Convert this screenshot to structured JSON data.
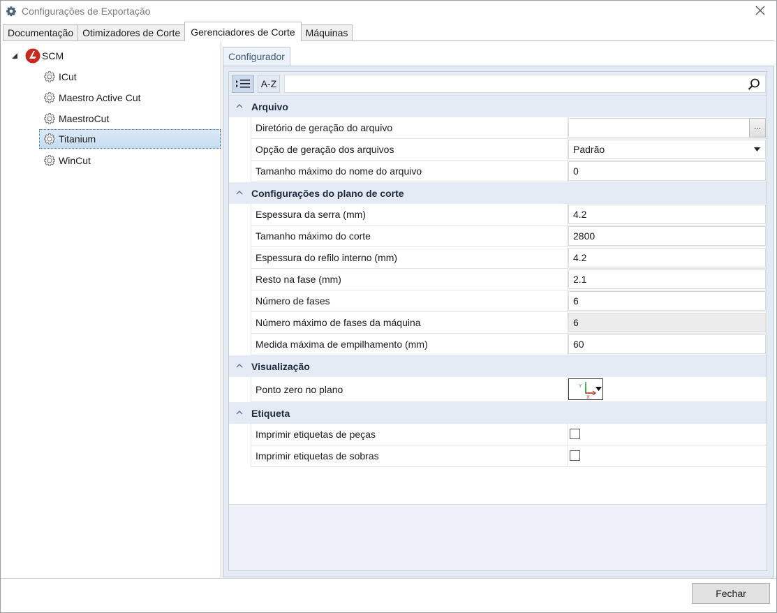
{
  "window": {
    "title": "Configurações de Exportação",
    "icon": "gear-icon",
    "close_icon": "close-icon"
  },
  "tabs": [
    {
      "label": "Documentação"
    },
    {
      "label": "Otimizadores de Corte"
    },
    {
      "label": "Gerenciadores de Corte",
      "active": true
    },
    {
      "label": "Máquinas"
    }
  ],
  "tree": {
    "root": {
      "label": "SCM",
      "icon": "scm-logo-icon"
    },
    "items": [
      {
        "label": "ICut",
        "icon": "gear-icon"
      },
      {
        "label": "Maestro Active Cut",
        "icon": "gear-icon"
      },
      {
        "label": "MaestroCut",
        "icon": "gear-icon"
      },
      {
        "label": "Titanium",
        "icon": "gear-icon",
        "selected": true
      },
      {
        "label": "WinCut",
        "icon": "gear-icon"
      }
    ]
  },
  "configurator": {
    "tab_label": "Configurador",
    "toolbar": {
      "categorized_icon": "categorized-icon",
      "alpha_label": "A-Z",
      "search_icon": "search-icon",
      "search_value": ""
    },
    "categories": [
      {
        "label": "Arquivo",
        "rows": [
          {
            "label": "Diretório de geração do arquivo",
            "value": "",
            "button": "..."
          },
          {
            "label": "Opção de geração dos arquivos",
            "value": "Padrão"
          },
          {
            "label": "Tamanho máximo do nome do arquivo",
            "value": "0"
          }
        ]
      },
      {
        "label": "Configurações do plano de corte",
        "rows": [
          {
            "label": "Espessura da serra (mm)",
            "value": "4.2"
          },
          {
            "label": "Tamanho máximo do corte",
            "value": "2800"
          },
          {
            "label": "Espessura do refilo interno (mm)",
            "value": "4.2"
          },
          {
            "label": "Resto na fase (mm)",
            "value": "2.1"
          },
          {
            "label": "Número de fases",
            "value": "6"
          },
          {
            "label": "Número máximo de fases da máquina",
            "value": "6",
            "readonly": true
          },
          {
            "label": "Medida máxima de empilhamento (mm)",
            "value": "60"
          }
        ]
      },
      {
        "label": "Visualização",
        "rows": [
          {
            "label": "Ponto zero no plano",
            "icon": "axis-origin-icon",
            "axis_y": "Y",
            "axis_x": "X"
          }
        ]
      },
      {
        "label": "Etiqueta",
        "rows": [
          {
            "label": "Imprimir etiquetas de peças",
            "checked": false
          },
          {
            "label": "Imprimir etiquetas de sobras",
            "checked": false
          }
        ]
      }
    ]
  },
  "footer": {
    "close_button_label": "Fechar"
  },
  "colors": {
    "scm_logo": "#c8281e",
    "selection": "#c6dcf3",
    "category_bg": "#e4ebf5",
    "axis_y": "#2ea043",
    "axis_x": "#d93025"
  }
}
